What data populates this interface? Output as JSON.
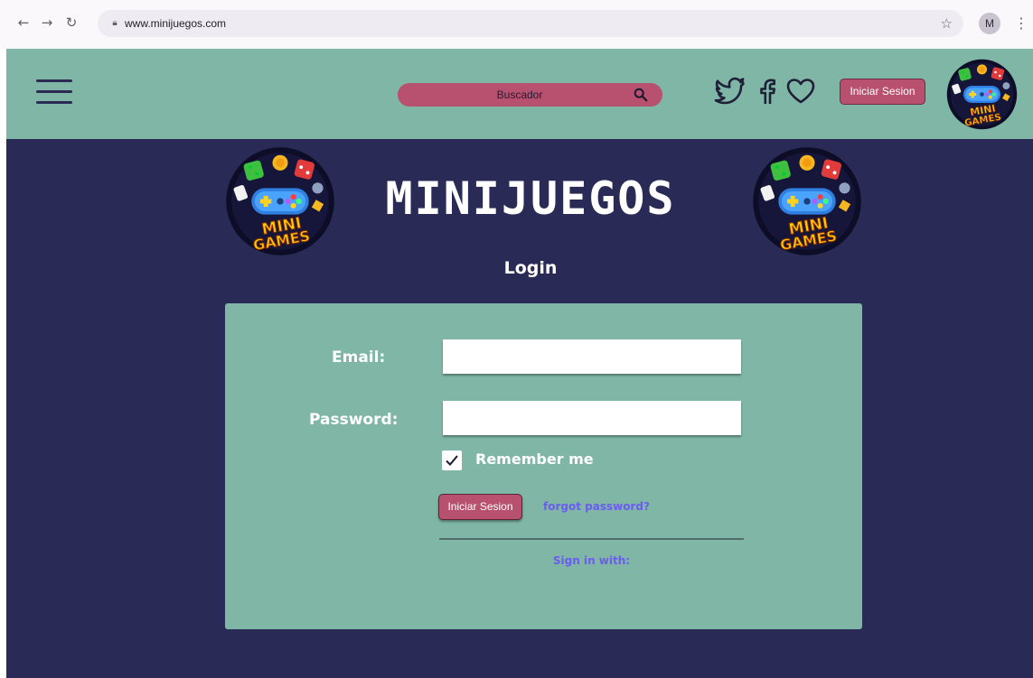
{
  "browser": {
    "url": "www.minijuegos.com",
    "profile_initial": "M",
    "icons": {
      "back": "arrow-left",
      "forward": "arrow-right",
      "reload": "reload",
      "lock": "lock",
      "bookmark": "star",
      "menu": "vertical-dots"
    }
  },
  "header": {
    "search": {
      "placeholder": "Buscador"
    },
    "social_icons": [
      "twitter",
      "facebook",
      "heart"
    ],
    "login_button": "Iniciar Sesion",
    "logo_text": [
      "MINI",
      "GAMES"
    ]
  },
  "main": {
    "title": "MINIJUEGOS",
    "logo_text": [
      "MINI",
      "GAMES"
    ],
    "login": {
      "heading": "Login",
      "email_label": "Email:",
      "email_value": "",
      "password_label": "Password:",
      "password_value": "",
      "remember_label": "Remember me",
      "remember_checked": true,
      "submit_label": "Iniciar Sesion",
      "forgot_label": "forgot password?",
      "sign_in_with": "Sign in with:"
    }
  },
  "colors": {
    "header_bg": "#7fb6a5",
    "main_bg": "#292a55",
    "accent_pink": "#b8506f",
    "link_purple": "#6c5cf0"
  }
}
